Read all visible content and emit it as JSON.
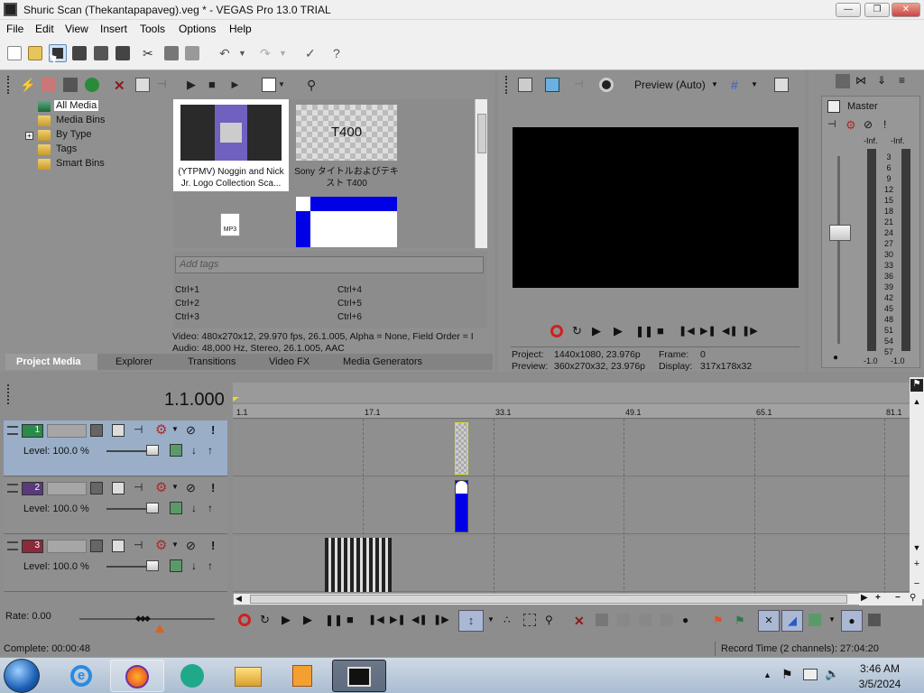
{
  "window": {
    "title": "Shuric Scan (Thekantapapaveg).veg * - VEGAS Pro 13.0 TRIAL"
  },
  "menu": [
    "File",
    "Edit",
    "View",
    "Insert",
    "Tools",
    "Options",
    "Help"
  ],
  "media_tree": [
    "All Media",
    "Media Bins",
    "By Type",
    "Tags",
    "Smart Bins"
  ],
  "media_items": [
    {
      "label": "(YTPMV) Noggin and Nick Jr. Logo Collection Sca..."
    },
    {
      "label": "Sony タイトルおよびテキスト T400",
      "thumb_text": "T400"
    }
  ],
  "tags": {
    "placeholder": "Add tags",
    "shortcuts": [
      "Ctrl+1",
      "Ctrl+4",
      "Ctrl+2",
      "Ctrl+5",
      "Ctrl+3",
      "Ctrl+6"
    ]
  },
  "media_info": {
    "video": "Video: 480x270x12, 29.970 fps, 26.1.005, Alpha = None, Field Order = I",
    "audio": "Audio: 48,000 Hz, Stereo, 26.1.005, AAC"
  },
  "panel_tabs": [
    "Project Media",
    "Explorer",
    "Transitions",
    "Video FX",
    "Media Generators"
  ],
  "preview": {
    "mode": "Preview (Auto)",
    "project_label": "Project:",
    "project_value": "1440x1080, 23.976p",
    "preview_label": "Preview:",
    "preview_value": "360x270x32, 23.976p",
    "frame_label": "Frame:",
    "frame_value": "0",
    "display_label": "Display:",
    "display_value": "317x178x32"
  },
  "master": {
    "title": "Master",
    "peak_left": "-Inf.",
    "peak_right": "-Inf.",
    "scale": [
      "3",
      "6",
      "9",
      "12",
      "15",
      "18",
      "21",
      "24",
      "27",
      "30",
      "33",
      "36",
      "39",
      "42",
      "45",
      "48",
      "51",
      "54",
      "57"
    ],
    "level_left": "-1.0",
    "level_right": "-1.0"
  },
  "timeline": {
    "time": "1.1.000",
    "ruler": [
      "1.1",
      "17.1",
      "33.1",
      "49.1",
      "65.1",
      "81.1"
    ],
    "tracks": [
      {
        "number": "1",
        "level": "Level: 100.0 %",
        "color": "#2a8a4a"
      },
      {
        "number": "2",
        "level": "Level: 100.0 %",
        "color": "#5a3a7a"
      },
      {
        "number": "3",
        "level": "Level: 100.0 %",
        "color": "#8a2a3a"
      }
    ],
    "rate": "Rate: 0.00"
  },
  "status": {
    "complete": "Complete: 00:00:48",
    "record_time": "Record Time (2 channels): 27:04:20"
  },
  "taskbar": {
    "time": "3:46 AM",
    "date": "3/5/2024"
  },
  "colors": {
    "clip_blue": "#0000e6",
    "record_red": "#d02020",
    "selected_track": "#9aaec8"
  }
}
